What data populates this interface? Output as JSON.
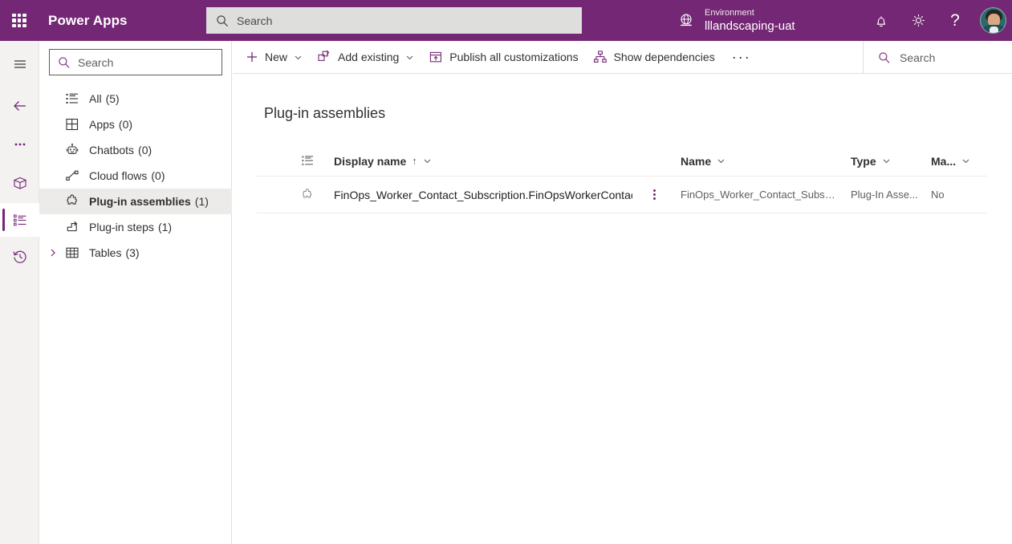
{
  "suite": {
    "brand": "Power Apps",
    "waffle_icon": "waffle-grid-icon",
    "search": {
      "placeholder": "Search",
      "icon": "search-icon"
    },
    "environment": {
      "icon": "environment-globe-icon",
      "label": "Environment",
      "value": "lllandscaping-uat"
    },
    "icons": [
      {
        "name": "notifications-bell-icon",
        "glyph": "bell"
      },
      {
        "name": "settings-gear-icon",
        "glyph": "gear"
      },
      {
        "name": "help-question-icon",
        "glyph": "?"
      }
    ],
    "avatar": {
      "name": "user-avatar",
      "alt": "User profile photo"
    },
    "colors": {
      "brand_purple": "#742774",
      "search_bg": "#dededd"
    }
  },
  "rail": {
    "items": [
      {
        "name": "hamburger-menu-icon",
        "selected": false
      },
      {
        "name": "back-arrow-icon",
        "selected": false
      },
      {
        "name": "more-ellipsis-icon",
        "selected": false
      },
      {
        "name": "solutions-icon",
        "selected": false
      },
      {
        "name": "objects-list-icon",
        "selected": true
      },
      {
        "name": "history-clock-icon",
        "selected": false
      }
    ]
  },
  "sidebar": {
    "search": {
      "placeholder": "Search",
      "icon": "search-icon"
    },
    "items": [
      {
        "label": "All",
        "count": "(5)",
        "icon": "list-icon",
        "selected": false,
        "expandable": false
      },
      {
        "label": "Apps",
        "count": "(0)",
        "icon": "apps-grid-icon",
        "selected": false,
        "expandable": false
      },
      {
        "label": "Chatbots",
        "count": "(0)",
        "icon": "chatbot-robot-icon",
        "selected": false,
        "expandable": false
      },
      {
        "label": "Cloud flows",
        "count": "(0)",
        "icon": "cloud-flow-icon",
        "selected": false,
        "expandable": false
      },
      {
        "label": "Plug-in assemblies",
        "count": "(1)",
        "icon": "puzzle-piece-icon",
        "selected": true,
        "expandable": false
      },
      {
        "label": "Plug-in steps",
        "count": "(1)",
        "icon": "plugin-step-icon",
        "selected": false,
        "expandable": false
      },
      {
        "label": "Tables",
        "count": "(3)",
        "icon": "table-icon",
        "selected": false,
        "expandable": true
      }
    ]
  },
  "commandbar": {
    "new_label": "New",
    "add_existing_label": "Add existing",
    "publish_label": "Publish all customizations",
    "dependencies_label": "Show dependencies",
    "overflow_label": "···",
    "search": {
      "placeholder": "Search",
      "icon": "search-icon"
    }
  },
  "main": {
    "page_title": "Plug-in assemblies",
    "columns": [
      {
        "label": "Display name",
        "sort": "↑",
        "has_chevron": true
      },
      {
        "label": "Name",
        "sort": "",
        "has_chevron": true
      },
      {
        "label": "Type",
        "sort": "",
        "has_chevron": true
      },
      {
        "label": "Ma...",
        "sort": "",
        "has_chevron": true
      }
    ],
    "rows": [
      {
        "icon": "puzzle-piece-icon",
        "display_name": "FinOps_Worker_Contact_Subscription.FinOpsWorkerContactS",
        "name": "FinOps_Worker_Contact_Subscripti...",
        "type": "Plug-In Asse...",
        "managed": "No",
        "kebab": "row-more-options-icon"
      }
    ]
  }
}
